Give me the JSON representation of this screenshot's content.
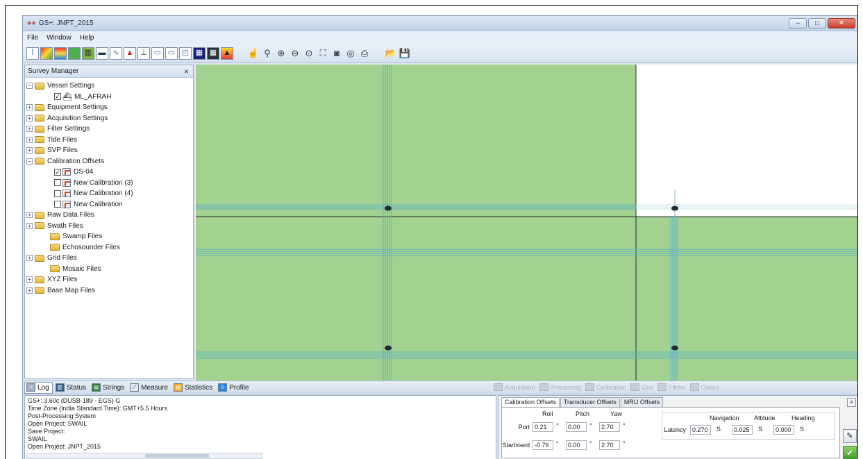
{
  "window": {
    "title": "GS+: JNPT_2015",
    "minimize": "–",
    "maximize": "□",
    "close": "✕"
  },
  "menu": [
    "File",
    "Window",
    "Help"
  ],
  "toolbar_icons": [
    "line-chart-icon",
    "color-map-icon",
    "layers-icon",
    "green-grid-icon",
    "bars-icon",
    "boat-icon",
    "profile-icon",
    "depth-icon",
    "survey-line-icon",
    "window-icon",
    "window-alt-icon",
    "chart-window-icon",
    "mosaic-icon",
    "grid-icon",
    "terrain-icon",
    "pan-hand-icon",
    "zoom-icon",
    "zoom-in-icon",
    "zoom-out-icon",
    "zoom-box-icon",
    "zoom-extent-icon",
    "camera-icon",
    "target-icon",
    "print-icon",
    "open-folder-icon",
    "save-icon"
  ],
  "survey_manager": {
    "title": "Survey Manager",
    "close": "×",
    "nodes": [
      {
        "label": "Vessel Settings",
        "level": 1,
        "expander": "−",
        "kind": "folder"
      },
      {
        "label": "ML_AFRAH",
        "level": 3,
        "kind": "vessel",
        "checked": true
      },
      {
        "label": "Equipment Settings",
        "level": 1,
        "expander": "+",
        "kind": "folder"
      },
      {
        "label": "Acquisition Settings",
        "level": 1,
        "expander": "+",
        "kind": "folder"
      },
      {
        "label": "Filter Settings",
        "level": 1,
        "expander": "+",
        "kind": "folder"
      },
      {
        "label": "Tide Files",
        "level": 1,
        "expander": "+",
        "kind": "folder"
      },
      {
        "label": "SVP Files",
        "level": 1,
        "expander": "+",
        "kind": "folder"
      },
      {
        "label": "Calibration Offsets",
        "level": 1,
        "expander": "−",
        "kind": "folder"
      },
      {
        "label": "DS-04",
        "level": 3,
        "kind": "calibration",
        "checked": true
      },
      {
        "label": "New Calibration (3)",
        "level": 3,
        "kind": "calibration",
        "checked": false
      },
      {
        "label": "New Calibration (4)",
        "level": 3,
        "kind": "calibration",
        "checked": false
      },
      {
        "label": "New Calibration",
        "level": 3,
        "kind": "calibration",
        "checked": false
      },
      {
        "label": "Raw Data Files",
        "level": 1,
        "expander": "+",
        "kind": "folder"
      },
      {
        "label": "Swath Files",
        "level": 1,
        "expander": "+",
        "kind": "folder"
      },
      {
        "label": "Swamp Files",
        "level": 2,
        "kind": "folder"
      },
      {
        "label": "Echosounder Files",
        "level": 2,
        "kind": "folder"
      },
      {
        "label": "Grid Files",
        "level": 1,
        "expander": "+",
        "kind": "folder"
      },
      {
        "label": "Mosaic Files",
        "level": 2,
        "kind": "folder"
      },
      {
        "label": "XYZ Files",
        "level": 1,
        "expander": "+",
        "kind": "folder"
      },
      {
        "label": "Base Map Files",
        "level": 1,
        "expander": "+",
        "kind": "folder"
      }
    ]
  },
  "map": {
    "fill_color": "#a3d290",
    "track_color": "#5cb0c4",
    "empty_color": "#ffffff"
  },
  "bottom_tabs": [
    {
      "label": "Log",
      "icon": "log-icon",
      "active": true
    },
    {
      "label": "Status",
      "icon": "status-icon",
      "active": false
    },
    {
      "label": "Strings",
      "icon": "strings-icon",
      "active": false
    },
    {
      "label": "Measure",
      "icon": "measure-icon",
      "active": false
    },
    {
      "label": "Statistics",
      "icon": "statistics-icon",
      "active": false
    },
    {
      "label": "Profile",
      "icon": "profile-chart-icon",
      "active": false
    }
  ],
  "process_tabs": [
    "Acquisition",
    "Processing",
    "Calibration",
    "Grid",
    "Filters",
    "Colour"
  ],
  "log_lines": [
    "GS+: 3.60c (DUSB-189 - EGS) G",
    "Time Zone (India Standard Time): GMT+5.5 Hours",
    "Post-Processing System",
    "Open Project: SWAIL",
    "Save Project:",
    "SWAIL",
    "Open Project: JNPT_2015"
  ],
  "calibration": {
    "tabs": [
      "Calibration Offsets",
      "Transducer Offsets",
      "MRU Offsets"
    ],
    "columns": [
      "Roll",
      "Pitch",
      "Yaw"
    ],
    "rows": [
      {
        "label": "Port",
        "roll": "0.21",
        "pitch": "0.00",
        "yaw": "2.70"
      },
      {
        "label": "Starboard",
        "roll": "-0.76",
        "pitch": "0.00",
        "yaw": "2.70"
      }
    ],
    "unit_degree": "°",
    "nav_columns": [
      "Navigation",
      "Attitude",
      "Heading"
    ],
    "latency_label": "Latency",
    "latency": [
      {
        "value": "0.270",
        "unit": "S"
      },
      {
        "value": "0.025",
        "unit": "S"
      },
      {
        "value": "0.000",
        "unit": "S"
      }
    ],
    "close": "×",
    "ok": "✔",
    "edit": "✎"
  }
}
